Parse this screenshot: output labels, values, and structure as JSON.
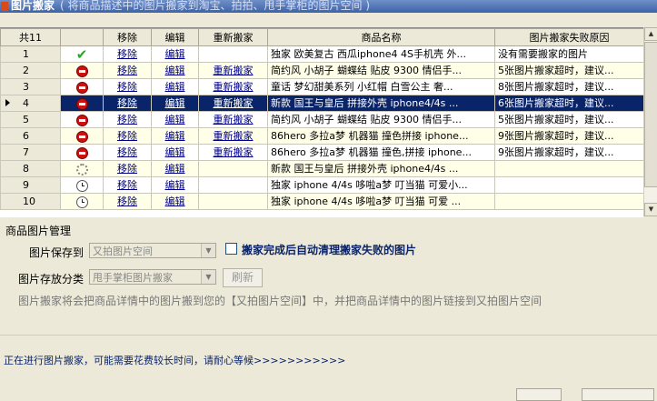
{
  "window": {
    "title": "图片搬家",
    "subtitle": "( 将商品描述中的图片搬家到淘宝、拍拍、甩手掌柜的图片空间 )"
  },
  "table": {
    "headers": [
      "共11",
      "",
      "移除",
      "编辑",
      "重新搬家",
      "商品名称",
      "图片搬家失败原因"
    ],
    "rows": [
      {
        "num": "1",
        "icon": "checkmark-icon",
        "remove": "移除",
        "edit": "编辑",
        "retry": "",
        "name": "独家 欧美复古 西瓜iphone4 4S手机壳 外...",
        "reason": "没有需要搬家的图片"
      },
      {
        "num": "2",
        "icon": "no-entry-icon",
        "remove": "移除",
        "edit": "编辑",
        "retry": "重新搬家",
        "name": "简约风 小胡子 蝴蝶结 贴皮 9300 情侣手...",
        "reason": "5张图片搬家超时，建议..."
      },
      {
        "num": "3",
        "icon": "no-entry-icon",
        "remove": "移除",
        "edit": "编辑",
        "retry": "重新搬家",
        "name": "童话 梦幻甜美系列 小红帽 白雪公主 奢...",
        "reason": "8张图片搬家超时，建议..."
      },
      {
        "num": "4",
        "icon": "no-entry-icon",
        "remove": "移除",
        "edit": "编辑",
        "retry": "重新搬家",
        "name": "新款 国王与皇后 拼接外壳 iphone4/4s ...",
        "reason": "6张图片搬家超时，建议..."
      },
      {
        "num": "5",
        "icon": "no-entry-icon",
        "remove": "移除",
        "edit": "编辑",
        "retry": "重新搬家",
        "name": "简约风 小胡子 蝴蝶结 贴皮 9300 情侣手...",
        "reason": "5张图片搬家超时，建议..."
      },
      {
        "num": "6",
        "icon": "no-entry-icon",
        "remove": "移除",
        "edit": "编辑",
        "retry": "重新搬家",
        "name": "86hero 多拉a梦 机器猫 撞色拼接 iphone...",
        "reason": "9张图片搬家超时，建议..."
      },
      {
        "num": "7",
        "icon": "no-entry-icon",
        "remove": "移除",
        "edit": "编辑",
        "retry": "重新搬家",
        "name": "86hero 多拉a梦 机器猫 撞色,拼接 iphone...",
        "reason": "9张图片搬家超时，建议..."
      },
      {
        "num": "8",
        "icon": "loading-icon",
        "remove": "移除",
        "edit": "编辑",
        "retry": "",
        "name": "新款 国王与皇后 拼接外壳 iphone4/4s ...",
        "reason": ""
      },
      {
        "num": "9",
        "icon": "clock-icon",
        "remove": "移除",
        "edit": "编辑",
        "retry": "",
        "name": "独家 iphone 4/4s 哆啦a梦 叮当猫 可爱小...",
        "reason": ""
      },
      {
        "num": "10",
        "icon": "clock-icon",
        "remove": "移除",
        "edit": "编辑",
        "retry": "",
        "name": "独家 iphone 4/4s 哆啦a梦 叮当猫 可爱 ...",
        "reason": ""
      }
    ]
  },
  "panel": {
    "title": "商品图片管理",
    "save_to_label": "图片保存到",
    "save_to_value": "又拍图片空间",
    "auto_clean_label": "搬家完成后自动清理搬家失败的图片",
    "category_label": "图片存放分类",
    "category_value": "甩手掌柜图片搬家",
    "refresh_label": "刷新",
    "hint": "图片搬家将会把商品详情中的图片搬到您的【又拍图片空间】中，并把商品详情中的图片链接到又拍图片空间"
  },
  "status": {
    "text": "正在进行图片搬家，可能需要花费较长时间，请耐心等候>>>>>>>>>>>"
  }
}
